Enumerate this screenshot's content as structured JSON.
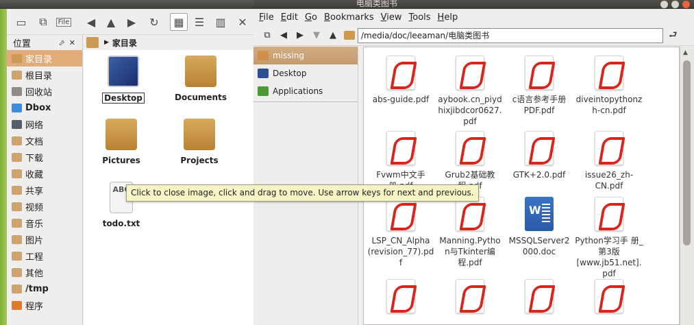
{
  "left_window": {
    "toolbar": {
      "buttons": [
        "new-window",
        "connect",
        "file",
        "back",
        "up",
        "forward",
        "reload",
        "icon-view",
        "detail-view",
        "split-view",
        "close"
      ]
    },
    "sidebar": {
      "title": "位置",
      "items": [
        {
          "label": "家目录",
          "icon": "home-folder-icon",
          "selected": true
        },
        {
          "label": "根目录",
          "icon": "folder-icon"
        },
        {
          "label": "回收站",
          "icon": "trash-icon"
        },
        {
          "label": "Dbox",
          "icon": "dbox-icon",
          "bold": true
        },
        {
          "label": "网络",
          "icon": "network-icon"
        },
        {
          "label": "文档",
          "icon": "folder-icon"
        },
        {
          "label": "下载",
          "icon": "folder-icon"
        },
        {
          "label": "收藏",
          "icon": "folder-icon"
        },
        {
          "label": "共享",
          "icon": "folder-icon"
        },
        {
          "label": "视频",
          "icon": "folder-icon"
        },
        {
          "label": "音乐",
          "icon": "folder-icon"
        },
        {
          "label": "图片",
          "icon": "folder-icon"
        },
        {
          "label": "工程",
          "icon": "folder-icon"
        },
        {
          "label": "其他",
          "icon": "folder-icon"
        },
        {
          "label": "/tmp",
          "icon": "folder-icon",
          "bold": true
        },
        {
          "label": "程序",
          "icon": "applications-icon"
        }
      ]
    },
    "path": {
      "crumb": "家目录"
    },
    "files": [
      {
        "label": "Desktop",
        "icon": "desktop-icon"
      },
      {
        "label": "Documents",
        "icon": "folder-icon"
      },
      {
        "label": "Pictures",
        "icon": "folder-icon"
      },
      {
        "label": "Projects",
        "icon": "folder-icon"
      },
      {
        "label": "todo.txt",
        "icon": "text-file-icon",
        "thumb_text": "ABC"
      }
    ]
  },
  "right_window": {
    "title": "电脑类图书",
    "menu": [
      "File",
      "Edit",
      "Go",
      "Bookmarks",
      "View",
      "Tools",
      "Help"
    ],
    "menu_underlines": [
      "F",
      "E",
      "G",
      "B",
      "V",
      "T",
      "H"
    ],
    "location": "/media/doc/leeaman/电脑类图书",
    "places": [
      {
        "label": "missing",
        "icon": "home-icon",
        "selected": true
      },
      {
        "label": "Desktop",
        "icon": "desktop-icon"
      },
      {
        "label": "Applications",
        "icon": "applications-icon"
      }
    ],
    "files": [
      {
        "label": "abs-guide.pdf",
        "type": "pdf"
      },
      {
        "label": "aybook.cn_piyd hixjibdcor0627. pdf",
        "type": "pdf"
      },
      {
        "label": "c语言参考手册 PDF.pdf",
        "type": "pdf"
      },
      {
        "label": "diveintopythonz h-cn.pdf",
        "type": "pdf"
      },
      {
        "label": "Fvwm中文手 册.pdf",
        "type": "pdf"
      },
      {
        "label": "Grub2基础教 程.pdf",
        "type": "pdf"
      },
      {
        "label": "GTK+2.0.pdf",
        "type": "pdf"
      },
      {
        "label": "issue26_zh- CN.pdf",
        "type": "pdf"
      },
      {
        "label": "LSP_CN_Alpha (revision_77).pd f",
        "type": "pdf"
      },
      {
        "label": "Manning.Pytho n与Tkinter编 程.pdf",
        "type": "pdf"
      },
      {
        "label": "MSSQLServer2 000.doc",
        "type": "doc"
      },
      {
        "label": "Python学习手 册_第3版 [www.jb51.net]. pdf",
        "type": "pdf"
      },
      {
        "label": "",
        "type": "pdf"
      },
      {
        "label": "",
        "type": "pdf"
      },
      {
        "label": "",
        "type": "pdf"
      },
      {
        "label": "",
        "type": "pdf"
      }
    ]
  },
  "tooltip": "Click to close image, click and drag to move. Use arrow keys for next and previous."
}
